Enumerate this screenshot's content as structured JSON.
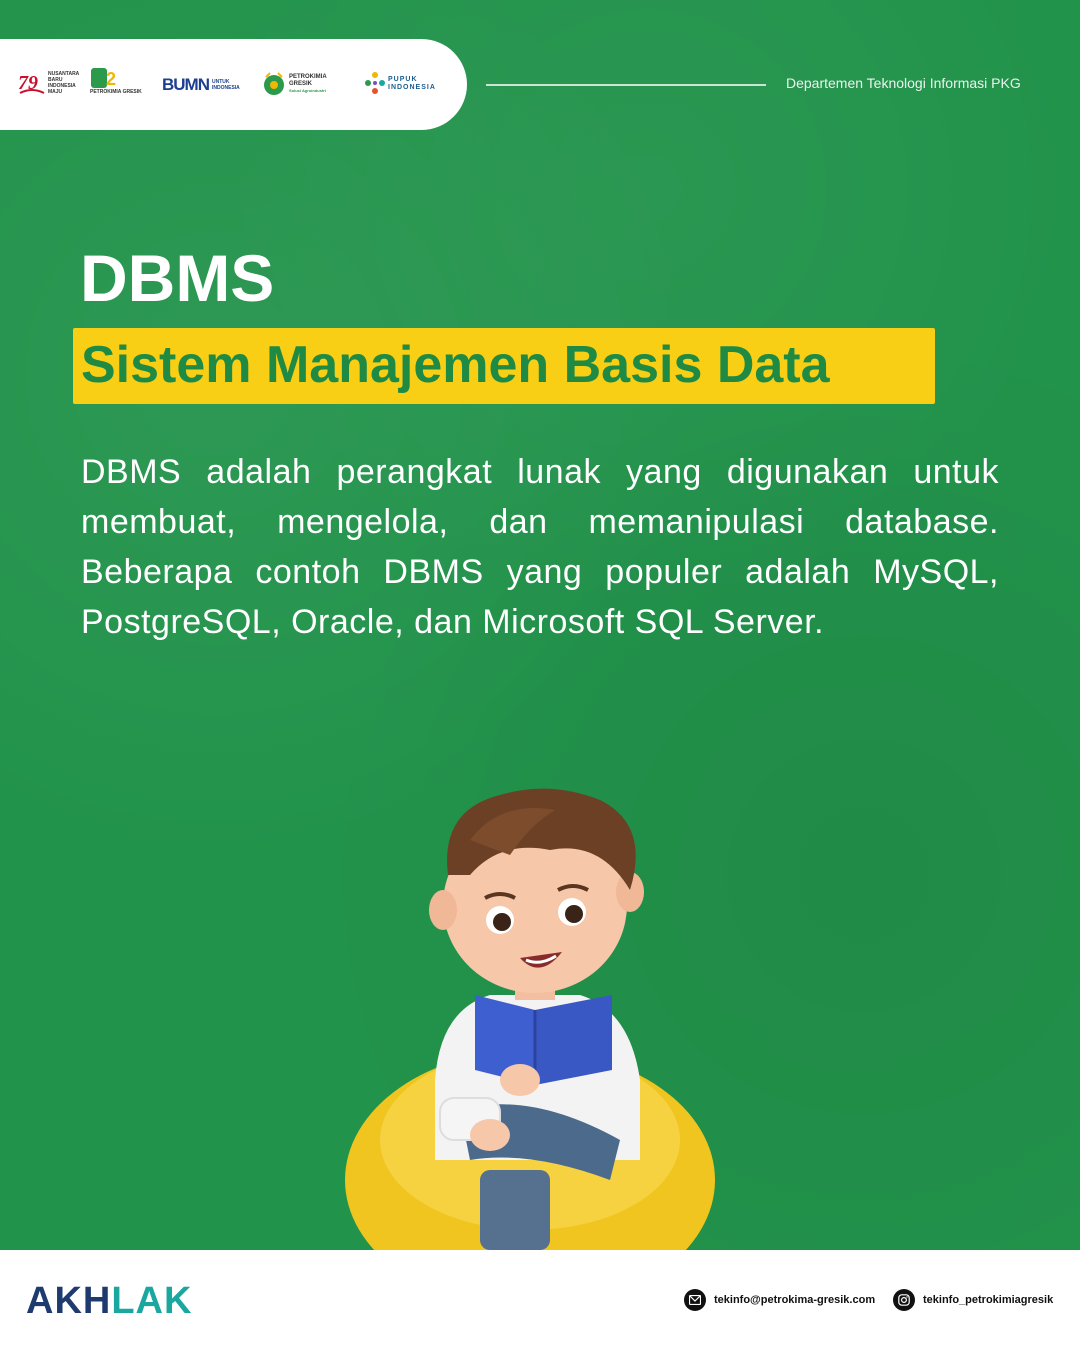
{
  "header": {
    "department": "Departemen Teknologi Informasi PKG",
    "logos": [
      {
        "name": "ri-79-logo",
        "text": "NUSANTARA BARU INDONESIA MAJU"
      },
      {
        "name": "petrokimia-52-logo",
        "text": "PETROKIMIA GRESIK"
      },
      {
        "name": "bumn-logo",
        "text": "BUMN",
        "subtext": "UNTUK INDONESIA"
      },
      {
        "name": "petrokimia-gresik-logo",
        "text": "PETROKIMIA GRESIK",
        "subtext": "Solusi Agroindustri"
      },
      {
        "name": "pupuk-indonesia-logo",
        "text": "PUPUK INDONESIA"
      }
    ]
  },
  "main": {
    "title": "DBMS",
    "subtitle": "Sistem Manajemen Basis Data",
    "body": "DBMS adalah perangkat lunak yang digunakan untuk membuat, mengelola, dan memanipulasi database. Beberapa contoh DBMS yang populer adalah MySQL, PostgreSQL, Oracle, dan Microsoft SQL Server."
  },
  "footer": {
    "brand": "AKHLAK",
    "email": "tekinfo@petrokima-gresik.com",
    "instagram": "tekinfo_petrokimiagresik"
  },
  "colors": {
    "background": "#22934b",
    "highlight": "#f9cf15",
    "subtitle_text": "#1f8a44",
    "akhlak_blue": "#1e3a6e",
    "akhlak_teal": "#1aa7a0"
  }
}
